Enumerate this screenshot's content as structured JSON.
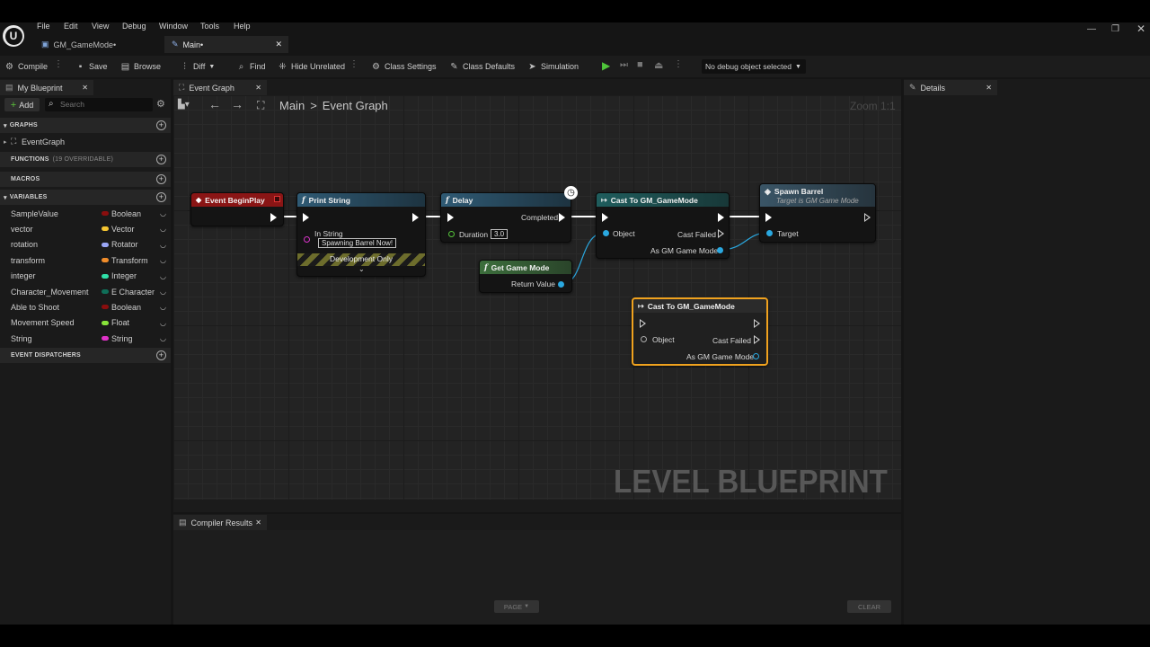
{
  "menu": [
    "File",
    "Edit",
    "View",
    "Debug",
    "Window",
    "Tools",
    "Help"
  ],
  "doc_tabs": [
    {
      "label": "GM_GameMode•"
    },
    {
      "label": "Main•"
    }
  ],
  "toolbar": {
    "compile": "Compile",
    "save": "Save",
    "browse": "Browse",
    "diff": "Diff",
    "find": "Find",
    "hide_unrelated": "Hide Unrelated",
    "class_settings": "Class Settings",
    "class_defaults": "Class Defaults",
    "simulation": "Simulation",
    "debug_object": "No debug object selected"
  },
  "my_blueprint": {
    "tab": "My Blueprint",
    "add": "Add",
    "search_placeholder": "Search",
    "graphs_header": "GRAPHS",
    "event_graph_item": "EventGraph",
    "functions_header": "FUNCTIONS",
    "functions_overridable": "(19 OVERRIDABLE)",
    "macros_header": "MACROS",
    "variables_header": "VARIABLES",
    "variables": [
      {
        "name": "SampleValue",
        "type": "Boolean",
        "color": "#8a0e0e"
      },
      {
        "name": "vector",
        "type": "Vector",
        "color": "#f5c531"
      },
      {
        "name": "rotation",
        "type": "Rotator",
        "color": "#9aa6f5"
      },
      {
        "name": "transform",
        "type": "Transform",
        "color": "#f08c2a"
      },
      {
        "name": "integer",
        "type": "Integer",
        "color": "#2fe0a8"
      },
      {
        "name": "Character_Movement",
        "type": "E Character I",
        "color": "#0f6e58"
      },
      {
        "name": "Able to Shoot",
        "type": "Boolean",
        "color": "#8a0e0e"
      },
      {
        "name": "Movement Speed",
        "type": "Float",
        "color": "#88e33a"
      },
      {
        "name": "String",
        "type": "String",
        "color": "#e032c8"
      }
    ],
    "event_dispatchers_header": "EVENT DISPATCHERS"
  },
  "graph": {
    "tab": "Event Graph",
    "breadcrumb_root": "Main",
    "breadcrumb_sep": ">",
    "breadcrumb_current": "Event Graph",
    "zoom": "Zoom 1:1",
    "watermark": "LEVEL BLUEPRINT",
    "nodes": {
      "begin_play": {
        "title": "Event BeginPlay",
        "color": "#8a1515"
      },
      "print_string": {
        "title": "Print String",
        "color": "#2f5a74",
        "in_string_label": "In String",
        "in_string_value": "Spawning Barrel Now!",
        "dev_only": "Development Only"
      },
      "delay": {
        "title": "Delay",
        "color": "#2f5a74",
        "completed": "Completed",
        "duration_label": "Duration",
        "duration_value": "3.0"
      },
      "cast1": {
        "title": "Cast To GM_GameMode",
        "color": "#1f5d5d",
        "object": "Object",
        "cast_failed": "Cast Failed",
        "as_gm": "As GM Game Mode"
      },
      "spawn_barrel": {
        "title": "Spawn Barrel",
        "subtitle": "Target is GM Game Mode",
        "color": "#3a5566",
        "target": "Target"
      },
      "get_game_mode": {
        "title": "Get Game Mode",
        "color": "#3c6e3c",
        "return_value": "Return Value"
      },
      "cast2": {
        "title": "Cast To GM_GameMode",
        "color": "#2b2b2b",
        "object": "Object",
        "cast_failed": "Cast Failed",
        "as_gm": "As GM Game Mode",
        "selection_color": "#f0a21e"
      }
    }
  },
  "details": {
    "tab": "Details"
  },
  "compiler": {
    "tab": "Compiler Results",
    "page": "PAGE",
    "clear": "CLEAR"
  }
}
